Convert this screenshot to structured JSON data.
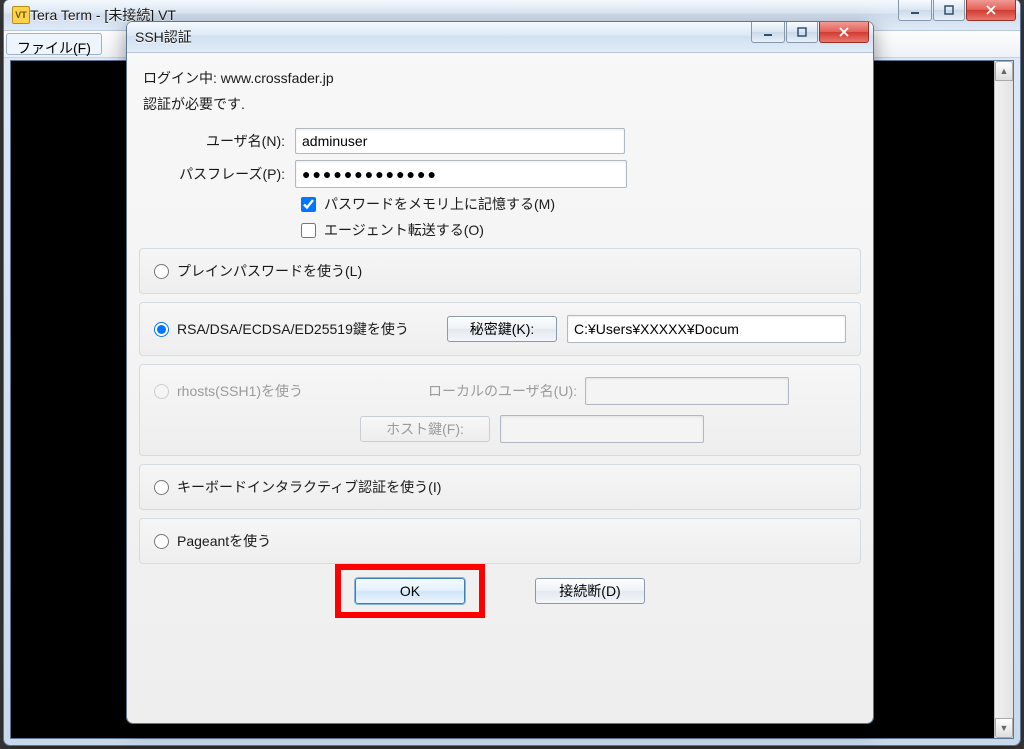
{
  "main_window": {
    "title": "Tera Term - [未接続] VT",
    "icon_label": "VT",
    "menu": {
      "file": "ファイル(F)"
    }
  },
  "dialog": {
    "title": "SSH認証",
    "login_line": "ログイン中: www.crossfader.jp",
    "auth_needed": "認証が必要です.",
    "username_label": "ユーザ名(N):",
    "username_value": "adminuser",
    "passphrase_label": "パスフレーズ(P):",
    "passphrase_masked": "●●●●●●●●●●●●●",
    "remember_label": "パスワードをメモリ上に記憶する(M)",
    "remember_checked": true,
    "agent_label": "エージェント転送する(O)",
    "agent_checked": false,
    "opt_plain": "プレインパスワードを使う(L)",
    "opt_rsa": "RSA/DSA/ECDSA/ED25519鍵を使う",
    "privkey_button": "秘密鍵(K):",
    "privkey_path": "C:¥Users¥XXXXX¥Docum",
    "opt_rhosts": "rhosts(SSH1)を使う",
    "local_user_label": "ローカルのユーザ名(U):",
    "hostkey_button": "ホスト鍵(F):",
    "opt_kbd": "キーボードインタラクティブ認証を使う(I)",
    "opt_pageant": "Pageantを使う",
    "ok": "OK",
    "disconnect": "接続断(D)",
    "selected_option": "rsa"
  }
}
